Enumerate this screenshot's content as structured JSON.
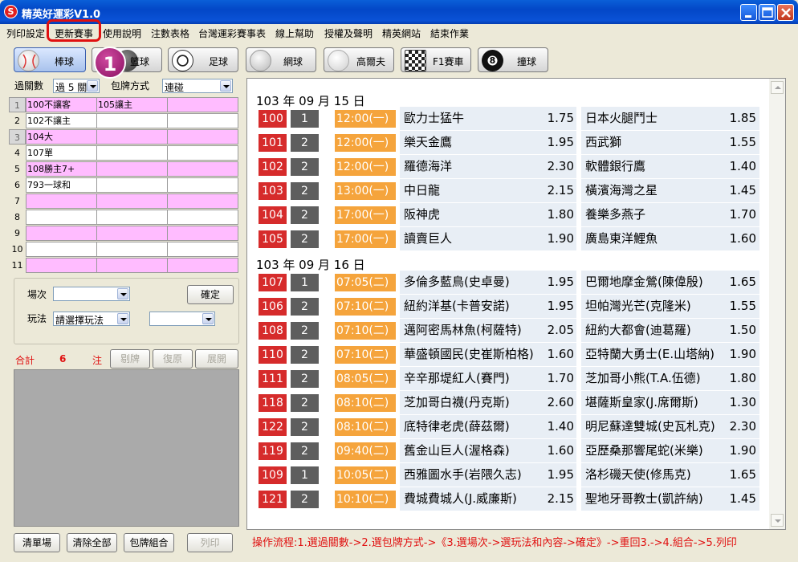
{
  "window": {
    "title": "精英好運彩V1.0",
    "app_icon": "S"
  },
  "menu": [
    {
      "label": "列印設定",
      "highlighted": false
    },
    {
      "label": "更新賽事",
      "highlighted": true
    },
    {
      "label": "使用說明",
      "highlighted": false
    },
    {
      "label": "注數表格",
      "highlighted": false
    },
    {
      "label": "台灣運彩賽事表",
      "highlighted": false
    },
    {
      "label": "線上幫助",
      "highlighted": false
    },
    {
      "label": "授權及聲明",
      "highlighted": false
    },
    {
      "label": "精英網站",
      "highlighted": false
    },
    {
      "label": "結束作業",
      "highlighted": false
    }
  ],
  "sports": [
    {
      "label": "棒球",
      "icon": "baseball-icon",
      "active": true
    },
    {
      "label": "籃球",
      "icon": "basketball-icon",
      "active": false
    },
    {
      "label": "足球",
      "icon": "soccer-ball-icon",
      "active": false
    },
    {
      "label": "網球",
      "icon": "tennis-ball-icon",
      "active": false
    },
    {
      "label": "高爾夫",
      "icon": "golf-ball-icon",
      "active": false
    },
    {
      "label": "F1賽車",
      "icon": "checkered-flag-icon",
      "active": false
    },
    {
      "label": "撞球",
      "icon": "eight-ball-icon",
      "active": false
    }
  ],
  "callout_badge": "1",
  "left_panel": {
    "parlay_label": "過關數",
    "parlay_value": "過 5 關",
    "combo_label": "包牌方式",
    "combo_value": "連碰",
    "rows": [
      {
        "num": "1",
        "cells": [
          "100不讓客",
          "105讓主",
          ""
        ],
        "color": "pink"
      },
      {
        "num": "2",
        "cells": [
          "102不讓主",
          "",
          ""
        ],
        "color": "white"
      },
      {
        "num": "3",
        "cells": [
          "104大",
          "",
          ""
        ],
        "color": "pink"
      },
      {
        "num": "4",
        "cells": [
          "107單",
          "",
          ""
        ],
        "color": "white"
      },
      {
        "num": "5",
        "cells": [
          "108勝主7+",
          "",
          ""
        ],
        "color": "pink"
      },
      {
        "num": "6",
        "cells": [
          "793一球和",
          "",
          ""
        ],
        "color": "white"
      },
      {
        "num": "7",
        "cells": [
          "",
          "",
          ""
        ],
        "color": "pink"
      },
      {
        "num": "8",
        "cells": [
          "",
          "",
          ""
        ],
        "color": "white"
      },
      {
        "num": "9",
        "cells": [
          "",
          "",
          ""
        ],
        "color": "pink"
      },
      {
        "num": "10",
        "cells": [
          "",
          "",
          ""
        ],
        "color": "white"
      },
      {
        "num": "11",
        "cells": [
          "",
          "",
          ""
        ],
        "color": "pink"
      }
    ],
    "match_label": "場次",
    "match_value": "",
    "confirm_label": "確定",
    "play_label": "玩法",
    "play_value": "請選擇玩法",
    "play_value2": "",
    "sum_label": "合計",
    "sum_count": "6",
    "sum_unit": "注",
    "remove_label": "剔牌",
    "restore_label": "復原",
    "expand_label": "展開",
    "clear_match_label": "清單場",
    "clear_all_label": "清除全部",
    "combo_set_label": "包牌組合",
    "print_label": "列印"
  },
  "schedule": [
    {
      "date": "103 年 09 月 15 日",
      "games": [
        {
          "id": "100",
          "n": "1",
          "time": "12:00(一)",
          "home": "歐力士猛牛",
          "home_odds": "1.75",
          "away": "日本火腿鬥士",
          "away_odds": "1.85"
        },
        {
          "id": "101",
          "n": "2",
          "time": "12:00(一)",
          "home": "樂天金鷹",
          "home_odds": "1.95",
          "away": "西武獅",
          "away_odds": "1.55"
        },
        {
          "id": "102",
          "n": "2",
          "time": "12:00(一)",
          "home": "羅德海洋",
          "home_odds": "2.30",
          "away": "軟體銀行鷹",
          "away_odds": "1.40"
        },
        {
          "id": "103",
          "n": "2",
          "time": "13:00(一)",
          "home": "中日龍",
          "home_odds": "2.15",
          "away": "橫濱海灣之星",
          "away_odds": "1.45"
        },
        {
          "id": "104",
          "n": "2",
          "time": "17:00(一)",
          "home": "阪神虎",
          "home_odds": "1.80",
          "away": "養樂多燕子",
          "away_odds": "1.70"
        },
        {
          "id": "105",
          "n": "2",
          "time": "17:00(一)",
          "home": "讀賣巨人",
          "home_odds": "1.90",
          "away": "廣島東洋鯉魚",
          "away_odds": "1.60"
        }
      ]
    },
    {
      "date": "103 年 09 月 16 日",
      "games": [
        {
          "id": "107",
          "n": "1",
          "time": "07:05(二)",
          "home": "多倫多藍鳥(史卓曼)",
          "home_odds": "1.95",
          "away": "巴爾地摩金鶯(陳偉殷)",
          "away_odds": "1.65"
        },
        {
          "id": "106",
          "n": "2",
          "time": "07:10(二)",
          "home": "紐約洋基(卡普安諾)",
          "home_odds": "1.95",
          "away": "坦帕灣光芒(克隆米)",
          "away_odds": "1.55"
        },
        {
          "id": "108",
          "n": "2",
          "time": "07:10(二)",
          "home": "邁阿密馬林魚(柯薩特)",
          "home_odds": "2.05",
          "away": "紐約大都會(迪葛羅)",
          "away_odds": "1.50"
        },
        {
          "id": "110",
          "n": "2",
          "time": "07:10(二)",
          "home": "華盛頓國民(史崔斯柏格)",
          "home_odds": "1.60",
          "away": "亞特蘭大勇士(E.山塔納)",
          "away_odds": "1.90"
        },
        {
          "id": "111",
          "n": "2",
          "time": "08:05(二)",
          "home": "辛辛那堤紅人(賽門)",
          "home_odds": "1.70",
          "away": "芝加哥小熊(T.A.伍德)",
          "away_odds": "1.80"
        },
        {
          "id": "118",
          "n": "2",
          "time": "08:10(二)",
          "home": "芝加哥白襪(丹克斯)",
          "home_odds": "2.60",
          "away": "堪薩斯皇家(J.席爾斯)",
          "away_odds": "1.30"
        },
        {
          "id": "122",
          "n": "2",
          "time": "08:10(二)",
          "home": "底特律老虎(薛茲爾)",
          "home_odds": "1.40",
          "away": "明尼蘇達雙城(史瓦札克)",
          "away_odds": "2.30"
        },
        {
          "id": "119",
          "n": "2",
          "time": "09:40(二)",
          "home": "舊金山巨人(渥格森)",
          "home_odds": "1.60",
          "away": "亞歷桑那響尾蛇(米樂)",
          "away_odds": "1.90"
        },
        {
          "id": "109",
          "n": "1",
          "time": "10:05(二)",
          "home": "西雅圖水手(岩隈久志)",
          "home_odds": "1.95",
          "away": "洛杉磯天使(修馬克)",
          "away_odds": "1.65"
        },
        {
          "id": "121",
          "n": "2",
          "time": "10:10(二)",
          "home": "費城費城人(J.威廉斯)",
          "home_odds": "2.15",
          "away": "聖地牙哥教士(凱許納)",
          "away_odds": "1.45"
        }
      ]
    }
  ],
  "status": "操作流程:1.選過關數->2.選包牌方式->《3.選場次->選玩法和內容->確定》->重回3.->4.組合->5.列印",
  "colors": {
    "id_bg": "#d62b2b",
    "n_bg": "#5e5e5e",
    "time_bg": "#f5a43c",
    "team_bg": "#e8eef5",
    "pink": "#ffbcff",
    "accent_red": "#e01010"
  }
}
